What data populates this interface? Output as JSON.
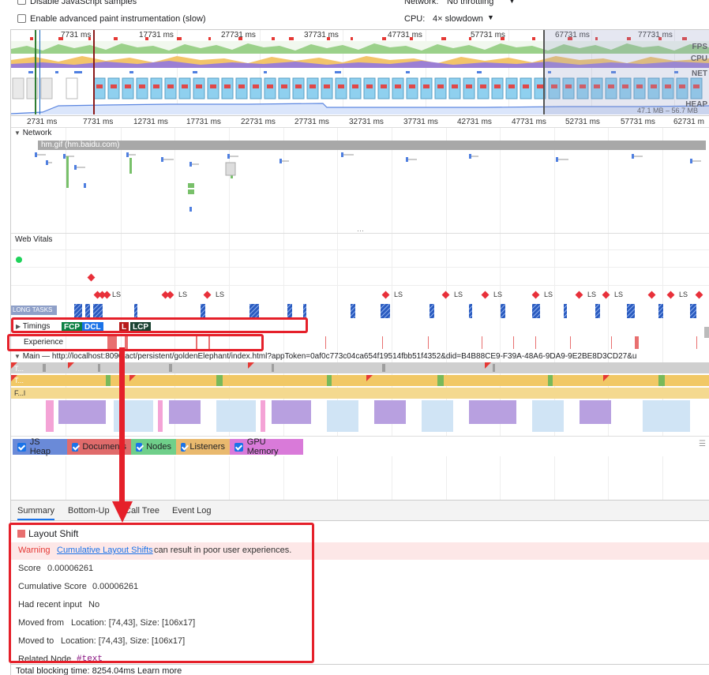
{
  "settings": {
    "disable_js_samples": "Disable JavaScript samples",
    "advanced_paint": "Enable advanced paint instrumentation (slow)",
    "network_label": "Network:",
    "network_value": "No throttling",
    "cpu_label": "CPU:",
    "cpu_value": "4× slowdown"
  },
  "overview": {
    "ticks": [
      "7731 ms",
      "17731 ms",
      "27731 ms",
      "37731 ms",
      "47731 ms",
      "57731 ms",
      "67731 ms",
      "77731 ms"
    ],
    "lanes": [
      "FPS",
      "CPU",
      "NET",
      "HEAP"
    ],
    "heap_range": "47.1 MB – 56.7 MB"
  },
  "ruler": {
    "ticks": [
      "2731 ms",
      "7731 ms",
      "12731 ms",
      "17731 ms",
      "22731 ms",
      "27731 ms",
      "32731 ms",
      "37731 ms",
      "42731 ms",
      "47731 ms",
      "52731 ms",
      "57731 ms",
      "62731 m"
    ]
  },
  "tracks": {
    "network": "Network",
    "network_item": "hm.gif (hm.baidu.com)",
    "web_vitals": "Web Vitals",
    "long_tasks": "LONG TASKS",
    "ls_label": "LS",
    "timings": "Timings",
    "timing_markers": [
      "FCP",
      "DCL",
      "L",
      "LCP"
    ],
    "experience": "Experience",
    "main": "Main — http://localhost:8090/act/persistent/goldenElephant/index.html?appToken=0af0c773c04ca654f19514fbb51f4352&did=B4B88CE9-F39A-48A6-9DA9-9E2BE8D3CD27&u",
    "main_rows": [
      "T...",
      "T...",
      "F...l"
    ]
  },
  "memory": {
    "checkboxes": [
      "JS Heap",
      "Documents",
      "Nodes",
      "Listeners",
      "GPU Memory"
    ],
    "colors": [
      "#6a8ad8",
      "#e06b6b",
      "#6fcf8a",
      "#e9b96e",
      "#d97ad9"
    ]
  },
  "bottom_tabs": [
    "Summary",
    "Bottom-Up",
    "Call Tree",
    "Event Log"
  ],
  "summary": {
    "title": "Layout Shift",
    "warning_label": "Warning",
    "warning_link": "Cumulative Layout Shifts",
    "warning_text": "can result in poor user experiences.",
    "score_label": "Score",
    "score_value": "0.00006261",
    "cumulative_label": "Cumulative Score",
    "cumulative_value": "0.00006261",
    "recent_input_label": "Had recent input",
    "recent_input_value": "No",
    "moved_from_label": "Moved from",
    "moved_from_value": "Location: [74,43], Size: [106x17]",
    "moved_to_label": "Moved to",
    "moved_to_value": "Location: [74,43], Size: [106x17]",
    "related_node_label": "Related Node",
    "related_node_value": "#text"
  },
  "footer": {
    "tbt": "Total blocking time: 8254.04ms",
    "learn_more": "Learn more"
  }
}
